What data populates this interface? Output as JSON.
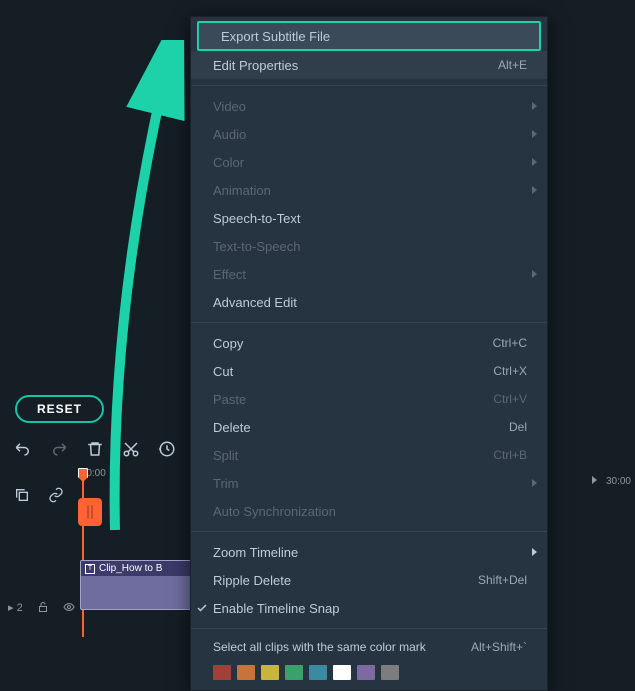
{
  "reset_label": "RESET",
  "ruler_start": ":00:00",
  "ruler_end": "30:00",
  "clip_label": "Clip_How to B",
  "track_label": "▸ 2",
  "context_menu": {
    "export_subtitle": "Export Subtitle File",
    "edit_properties": {
      "label": "Edit Properties",
      "shortcut": "Alt+E"
    },
    "video": "Video",
    "audio": "Audio",
    "color": "Color",
    "animation": "Animation",
    "speech_to_text": "Speech-to-Text",
    "text_to_speech": "Text-to-Speech",
    "effect": "Effect",
    "advanced_edit": "Advanced Edit",
    "copy": {
      "label": "Copy",
      "shortcut": "Ctrl+C"
    },
    "cut": {
      "label": "Cut",
      "shortcut": "Ctrl+X"
    },
    "paste": {
      "label": "Paste",
      "shortcut": "Ctrl+V"
    },
    "delete": {
      "label": "Delete",
      "shortcut": "Del"
    },
    "split": {
      "label": "Split",
      "shortcut": "Ctrl+B"
    },
    "trim": "Trim",
    "auto_sync": "Auto Synchronization",
    "zoom_timeline": "Zoom Timeline",
    "ripple_delete": {
      "label": "Ripple Delete",
      "shortcut": "Shift+Del"
    },
    "timeline_snap": "Enable Timeline Snap",
    "select_color": {
      "label": "Select all clips with the same color mark",
      "shortcut": "Alt+Shift+`"
    }
  },
  "color_swatches": [
    "#a14038",
    "#c8733a",
    "#c8b63a",
    "#3aa16a",
    "#3a8ba1",
    "#ffffff",
    "#7d6aa1",
    "#7d7d7d"
  ],
  "selected_swatch_index": 5
}
